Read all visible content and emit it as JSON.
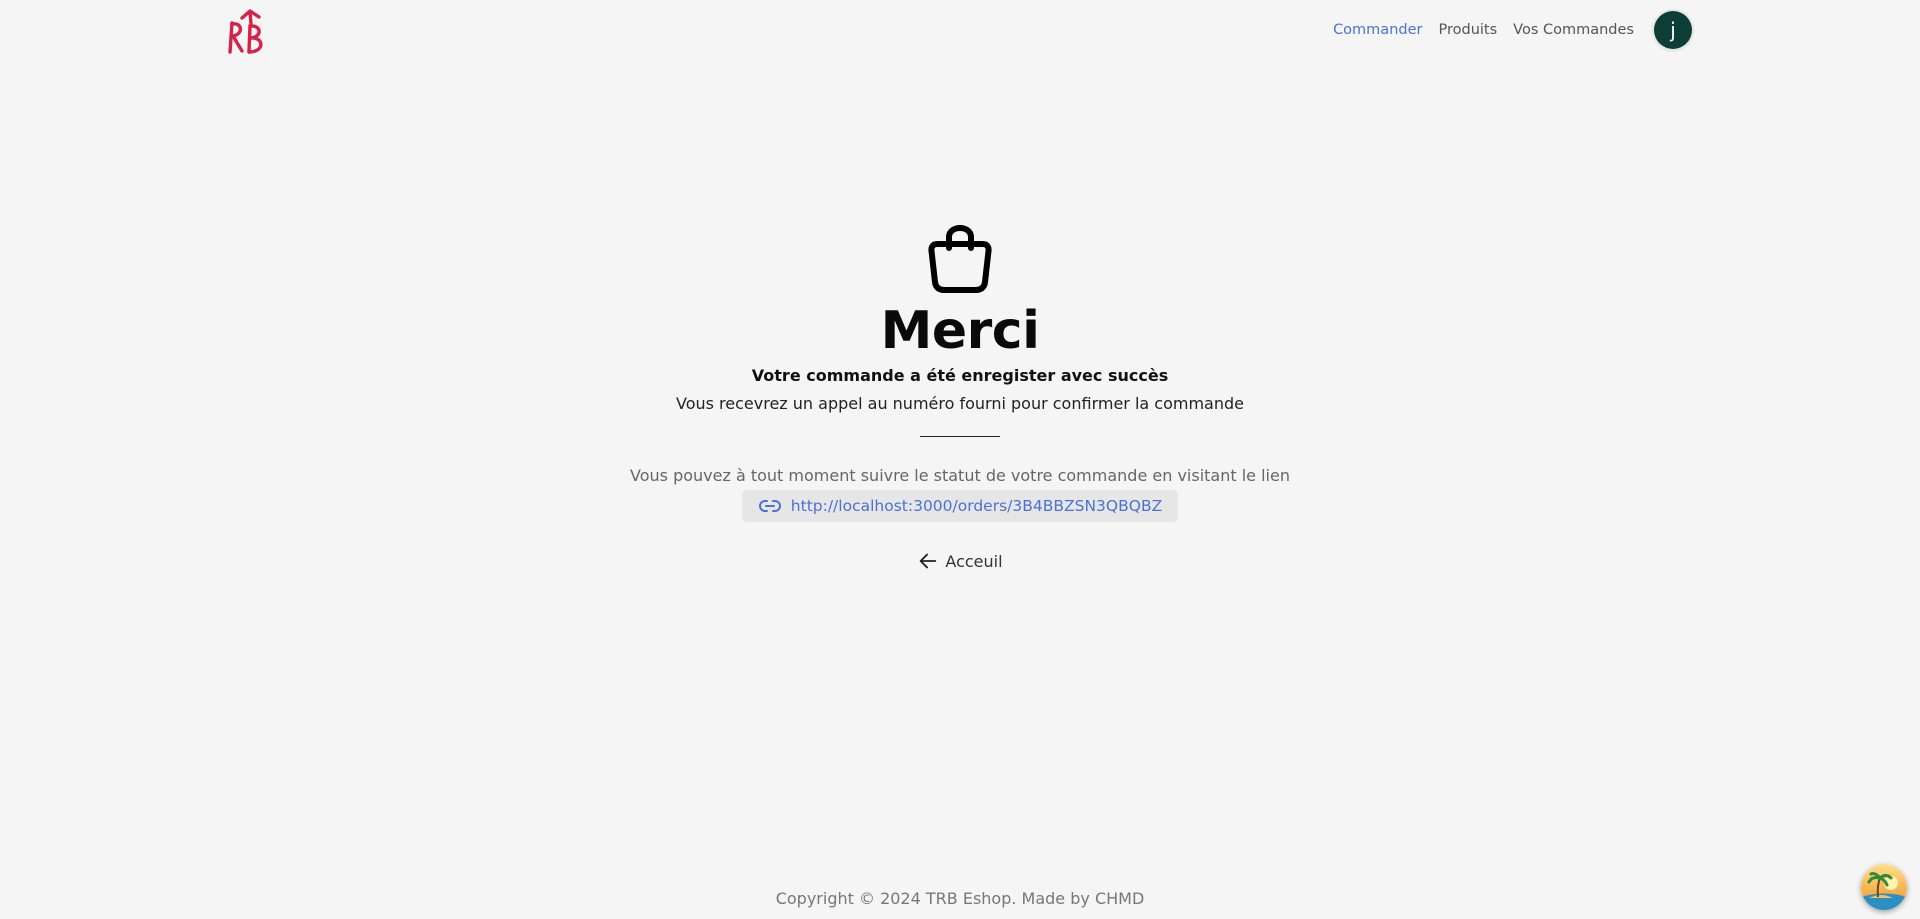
{
  "header": {
    "nav": [
      {
        "label": "Commander",
        "active": true
      },
      {
        "label": "Produits",
        "active": false
      },
      {
        "label": "Vos Commandes",
        "active": false
      }
    ],
    "avatar_initial": "j",
    "colors": {
      "active_link": "#4b72d3",
      "avatar_bg": "#0c3d36",
      "logo": "#d62246"
    }
  },
  "main": {
    "icon": "shopping-bag-icon",
    "title": "Merci",
    "subtitle": "Votre commande a été enregister avec succès",
    "description": "Vous recevrez un appel au numéro fourni pour confirmer la commande",
    "info": "Vous pouvez à tout moment suivre le statut de votre commande en visitant le lien",
    "link": {
      "icon": "link-icon",
      "url": "http://localhost:3000/orders/3B4BBZSN3QBQBZ"
    },
    "back": {
      "icon": "arrow-left-icon",
      "label": "Acceuil"
    }
  },
  "footer": {
    "text": "Copyright © 2024 TRB Eshop. Made by CHMD"
  },
  "widget": {
    "icon": "island-icon"
  }
}
